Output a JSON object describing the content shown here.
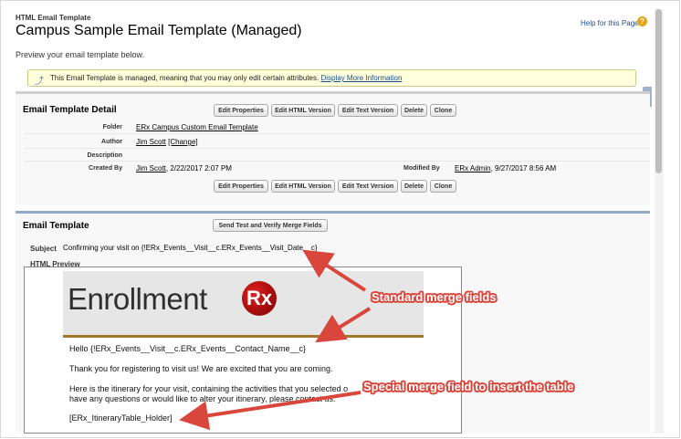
{
  "header": {
    "breadcrumb": "HTML Email Template",
    "title": "Campus Sample Email Template (Managed)",
    "help_link": "Help for this Page",
    "subtitle": "Preview your email template below."
  },
  "notice": {
    "text": "This Email Template is managed, meaning that you may only edit certain attributes.",
    "link": "Display More Information"
  },
  "detail": {
    "title": "Email Template Detail",
    "buttons": [
      "Edit Properties",
      "Edit HTML Version",
      "Edit Text Version",
      "Delete",
      "Clone"
    ],
    "folder_label": "Folder",
    "folder_value": "ERx Campus Custom Email Template",
    "author_label": "Author",
    "author_value": "Jim Scott",
    "author_change": "[Change]",
    "description_label": "Description",
    "created_by_label": "Created By",
    "created_by_user": "Jim Scott",
    "created_by_date": ", 2/22/2017 2:07 PM",
    "modified_by_label": "Modified By",
    "modified_by_user": "ERx Admin",
    "modified_by_date": ", 9/27/2017 8:56 AM"
  },
  "template": {
    "title": "Email Template",
    "send_button": "Send Test and Verify Merge Fields",
    "subject_label": "Subject",
    "subject_value": "Confirming your visit on {!ERx_Events__Visit__c.ERx_Events__Visit_Date__c}",
    "preview_tab": "HTML Preview"
  },
  "email": {
    "logo_text": "Enrollment",
    "logo_rx": "Rx",
    "greeting": "Hello {!ERx_Events__Visit__c.ERx_Events__Contact_Name__c}",
    "line1": "Thank you for registering to visit us! We are excited that you are coming.",
    "line2": "Here is the itinerary for your visit, containing the activities that you selected o",
    "line3": "have any questions or would like to alter your itinerary, please contact us.",
    "merge_table": "[ERx_ItineraryTable_Holder]"
  },
  "annotations": {
    "standard": "Standard merge fields",
    "special": "Special merge field to insert the table"
  },
  "colors": {
    "annotation": "#d9463c",
    "link": "#1a4d8f",
    "notice_bg": "#ffffdc"
  }
}
